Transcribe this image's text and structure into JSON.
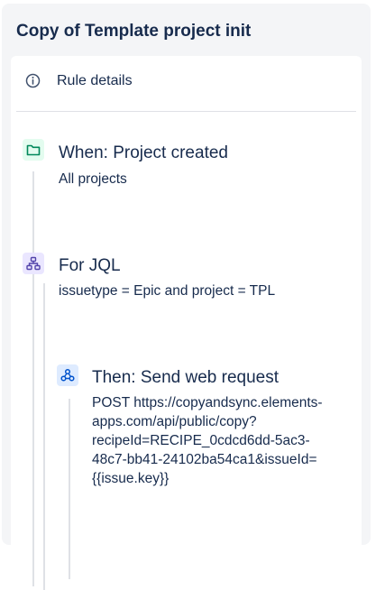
{
  "panel": {
    "title": "Copy of Template project init"
  },
  "details": {
    "label": "Rule details",
    "icon": "info-icon"
  },
  "steps": {
    "trigger": {
      "icon": "folder-icon",
      "title": "When: Project created",
      "subtitle": "All projects"
    },
    "branch": {
      "icon": "branch-icon",
      "title": "For JQL",
      "subtitle": "issuetype = Epic and project = TPL"
    },
    "action": {
      "icon": "webhook-icon",
      "title": "Then: Send web request",
      "lines": [
        "POST https://copyandsync.elements-",
        "apps.com/api/public/copy?",
        "recipeId=RECIPE_0cdcd6dd-5ac3-",
        "48c7-bb41-24102ba54ca1&issueId=",
        "{{issue.key}}"
      ]
    }
  },
  "colors": {
    "trigger_bg": "#e3fcef",
    "trigger_fg": "#00875a",
    "branch_bg": "#eae6ff",
    "branch_fg": "#5243aa",
    "action_bg": "#deebff",
    "action_fg": "#0052cc"
  }
}
